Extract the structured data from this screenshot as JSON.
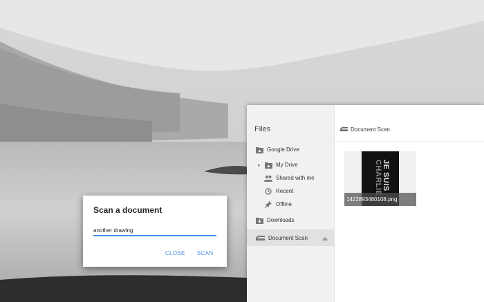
{
  "files_app": {
    "title": "Files",
    "sidebar": {
      "items": [
        {
          "label": "Google Drive",
          "icon": "drive-folder-icon"
        },
        {
          "label": "My Drive",
          "icon": "my-drive-icon"
        },
        {
          "label": "Shared with me",
          "icon": "people-icon"
        },
        {
          "label": "Recent",
          "icon": "clock-icon"
        },
        {
          "label": "Offline",
          "icon": "pin-icon"
        },
        {
          "label": "Downloads",
          "icon": "download-folder-icon"
        },
        {
          "label": "Document Scan",
          "icon": "scanner-icon",
          "selected": true
        }
      ]
    },
    "breadcrumb": "Document Scan",
    "files": [
      {
        "name": "1422893460108.png",
        "thumbnail_text_1": "JE SUIS",
        "thumbnail_text_2": "CHARLIE"
      }
    ]
  },
  "scan_dialog": {
    "title": "Scan a document",
    "input_value": "another drawing",
    "close_label": "CLOSE",
    "scan_label": "SCAN",
    "accent_color": "#4a90e2"
  }
}
